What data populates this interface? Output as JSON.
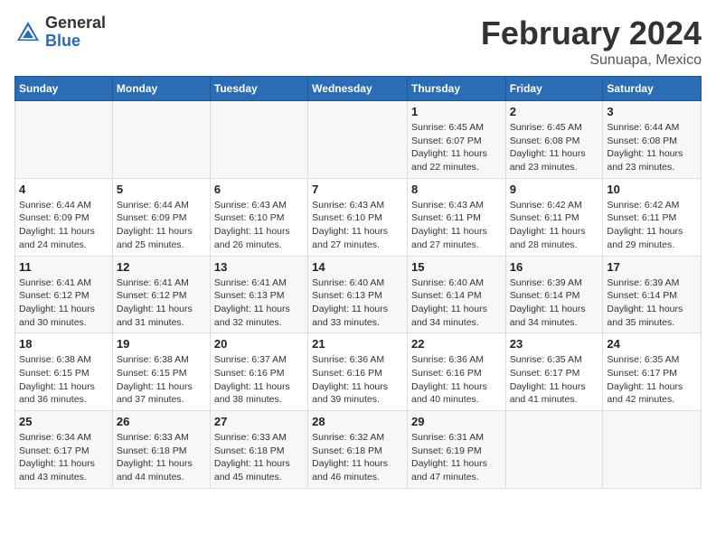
{
  "logo": {
    "general": "General",
    "blue": "Blue"
  },
  "title": "February 2024",
  "location": "Sunuapa, Mexico",
  "days_header": [
    "Sunday",
    "Monday",
    "Tuesday",
    "Wednesday",
    "Thursday",
    "Friday",
    "Saturday"
  ],
  "weeks": [
    [
      {
        "num": "",
        "info": ""
      },
      {
        "num": "",
        "info": ""
      },
      {
        "num": "",
        "info": ""
      },
      {
        "num": "",
        "info": ""
      },
      {
        "num": "1",
        "info": "Sunrise: 6:45 AM\nSunset: 6:07 PM\nDaylight: 11 hours\nand 22 minutes."
      },
      {
        "num": "2",
        "info": "Sunrise: 6:45 AM\nSunset: 6:08 PM\nDaylight: 11 hours\nand 23 minutes."
      },
      {
        "num": "3",
        "info": "Sunrise: 6:44 AM\nSunset: 6:08 PM\nDaylight: 11 hours\nand 23 minutes."
      }
    ],
    [
      {
        "num": "4",
        "info": "Sunrise: 6:44 AM\nSunset: 6:09 PM\nDaylight: 11 hours\nand 24 minutes."
      },
      {
        "num": "5",
        "info": "Sunrise: 6:44 AM\nSunset: 6:09 PM\nDaylight: 11 hours\nand 25 minutes."
      },
      {
        "num": "6",
        "info": "Sunrise: 6:43 AM\nSunset: 6:10 PM\nDaylight: 11 hours\nand 26 minutes."
      },
      {
        "num": "7",
        "info": "Sunrise: 6:43 AM\nSunset: 6:10 PM\nDaylight: 11 hours\nand 27 minutes."
      },
      {
        "num": "8",
        "info": "Sunrise: 6:43 AM\nSunset: 6:11 PM\nDaylight: 11 hours\nand 27 minutes."
      },
      {
        "num": "9",
        "info": "Sunrise: 6:42 AM\nSunset: 6:11 PM\nDaylight: 11 hours\nand 28 minutes."
      },
      {
        "num": "10",
        "info": "Sunrise: 6:42 AM\nSunset: 6:11 PM\nDaylight: 11 hours\nand 29 minutes."
      }
    ],
    [
      {
        "num": "11",
        "info": "Sunrise: 6:41 AM\nSunset: 6:12 PM\nDaylight: 11 hours\nand 30 minutes."
      },
      {
        "num": "12",
        "info": "Sunrise: 6:41 AM\nSunset: 6:12 PM\nDaylight: 11 hours\nand 31 minutes."
      },
      {
        "num": "13",
        "info": "Sunrise: 6:41 AM\nSunset: 6:13 PM\nDaylight: 11 hours\nand 32 minutes."
      },
      {
        "num": "14",
        "info": "Sunrise: 6:40 AM\nSunset: 6:13 PM\nDaylight: 11 hours\nand 33 minutes."
      },
      {
        "num": "15",
        "info": "Sunrise: 6:40 AM\nSunset: 6:14 PM\nDaylight: 11 hours\nand 34 minutes."
      },
      {
        "num": "16",
        "info": "Sunrise: 6:39 AM\nSunset: 6:14 PM\nDaylight: 11 hours\nand 34 minutes."
      },
      {
        "num": "17",
        "info": "Sunrise: 6:39 AM\nSunset: 6:14 PM\nDaylight: 11 hours\nand 35 minutes."
      }
    ],
    [
      {
        "num": "18",
        "info": "Sunrise: 6:38 AM\nSunset: 6:15 PM\nDaylight: 11 hours\nand 36 minutes."
      },
      {
        "num": "19",
        "info": "Sunrise: 6:38 AM\nSunset: 6:15 PM\nDaylight: 11 hours\nand 37 minutes."
      },
      {
        "num": "20",
        "info": "Sunrise: 6:37 AM\nSunset: 6:16 PM\nDaylight: 11 hours\nand 38 minutes."
      },
      {
        "num": "21",
        "info": "Sunrise: 6:36 AM\nSunset: 6:16 PM\nDaylight: 11 hours\nand 39 minutes."
      },
      {
        "num": "22",
        "info": "Sunrise: 6:36 AM\nSunset: 6:16 PM\nDaylight: 11 hours\nand 40 minutes."
      },
      {
        "num": "23",
        "info": "Sunrise: 6:35 AM\nSunset: 6:17 PM\nDaylight: 11 hours\nand 41 minutes."
      },
      {
        "num": "24",
        "info": "Sunrise: 6:35 AM\nSunset: 6:17 PM\nDaylight: 11 hours\nand 42 minutes."
      }
    ],
    [
      {
        "num": "25",
        "info": "Sunrise: 6:34 AM\nSunset: 6:17 PM\nDaylight: 11 hours\nand 43 minutes."
      },
      {
        "num": "26",
        "info": "Sunrise: 6:33 AM\nSunset: 6:18 PM\nDaylight: 11 hours\nand 44 minutes."
      },
      {
        "num": "27",
        "info": "Sunrise: 6:33 AM\nSunset: 6:18 PM\nDaylight: 11 hours\nand 45 minutes."
      },
      {
        "num": "28",
        "info": "Sunrise: 6:32 AM\nSunset: 6:18 PM\nDaylight: 11 hours\nand 46 minutes."
      },
      {
        "num": "29",
        "info": "Sunrise: 6:31 AM\nSunset: 6:19 PM\nDaylight: 11 hours\nand 47 minutes."
      },
      {
        "num": "",
        "info": ""
      },
      {
        "num": "",
        "info": ""
      }
    ]
  ]
}
